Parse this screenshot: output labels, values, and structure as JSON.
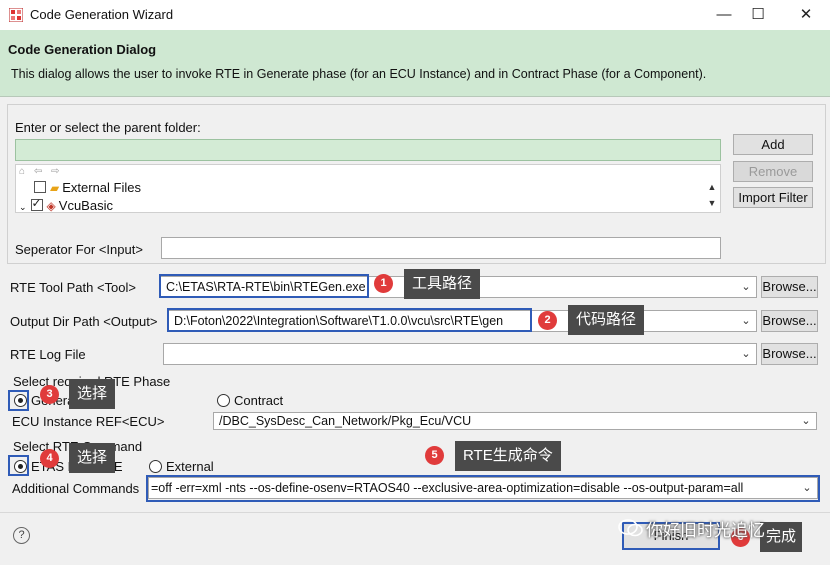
{
  "window": {
    "title": "Code Generation Wizard",
    "minimize": "—",
    "maximize": "☐",
    "close": "✕"
  },
  "header": {
    "title": "Code Generation Dialog",
    "description": "This dialog allows the user to invoke RTE in Generate phase (for an ECU Instance) and in Contract Phase (for a Component)."
  },
  "folder": {
    "label": "Enter or select the parent folder:",
    "value": "",
    "add": "Add",
    "remove": "Remove",
    "import_filter": "Import Filter",
    "toolbar_glyphs": "⌂ ⇦ ⇨",
    "items": [
      {
        "label": "External Files",
        "checked": false
      },
      {
        "label": "VcuBasic",
        "checked": true
      }
    ]
  },
  "separator": {
    "label": "Seperator For <Input>",
    "value": ""
  },
  "tool_path": {
    "label": "RTE Tool Path <Tool>",
    "value": "C:\\ETAS\\RTA-RTE\\bin\\RTEGen.exe",
    "browse": "Browse..."
  },
  "output_dir": {
    "label": "Output Dir Path <Output>",
    "value": "D:\\Foton\\2022\\Integration\\Software\\T1.0.0\\vcu\\src\\RTE\\gen",
    "browse": "Browse..."
  },
  "log_file": {
    "label": "RTE Log File",
    "value": "",
    "browse": "Browse..."
  },
  "phase": {
    "group_label": "Select required RTE Phase",
    "generate": "Generate",
    "contract": "Contract",
    "ecu_label": "ECU Instance REF<ECU>",
    "ecu_value": "/DBC_SysDesc_Can_Network/Pkg_Ecu/VCU"
  },
  "command": {
    "group_label": "Select RTE Command",
    "etas": "ETAS RTA-RTE",
    "external": "External",
    "additional_label": "Additional Commands",
    "additional_value": "=off -err=xml -nts --os-define-osenv=RTAOS40 --exclusive-area-optimization=disable --os-output-param=all"
  },
  "annotations": {
    "b1": "1",
    "c1": "工具路径",
    "b2": "2",
    "c2": "代码路径",
    "b3": "3",
    "c3": "选择",
    "b4": "4",
    "c4": "选择",
    "b5": "5",
    "c5": "RTE生成命令",
    "b6": "6",
    "c6": "完成"
  },
  "footer": {
    "help": "?",
    "finish": "Finish",
    "watermark": "你好旧时光追忆"
  }
}
